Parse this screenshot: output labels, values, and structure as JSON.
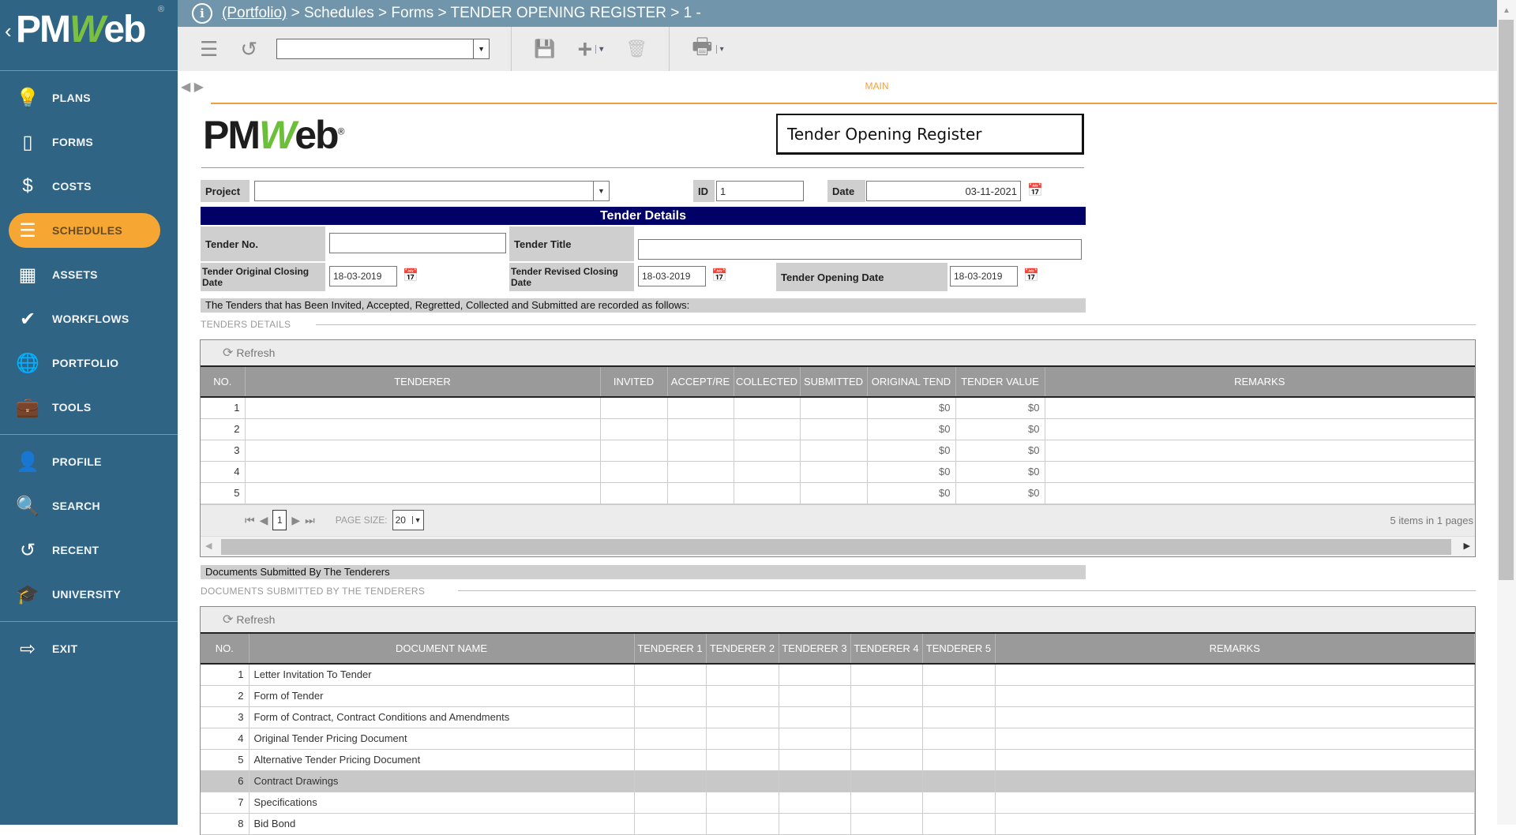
{
  "sidebar": {
    "logo": {
      "back": "‹",
      "text_pm": "PM",
      "text_w": "W",
      "text_eb": "eb",
      "reg": "®"
    },
    "group1": [
      {
        "label": "PLANS",
        "icon": "lightbulb-icon",
        "glyph": "💡"
      },
      {
        "label": "FORMS",
        "icon": "document-icon",
        "glyph": "▯"
      },
      {
        "label": "COSTS",
        "icon": "dollar-icon",
        "glyph": "$"
      },
      {
        "label": "SCHEDULES",
        "icon": "schedule-bars-icon",
        "glyph": "☰",
        "active": true
      },
      {
        "label": "ASSETS",
        "icon": "building-icon",
        "glyph": "▦"
      },
      {
        "label": "WORKFLOWS",
        "icon": "checkmark-icon",
        "glyph": "✔"
      },
      {
        "label": "PORTFOLIO",
        "icon": "globe-icon",
        "glyph": "🌐"
      },
      {
        "label": "TOOLS",
        "icon": "toolbox-icon",
        "glyph": "💼"
      }
    ],
    "group2": [
      {
        "label": "PROFILE",
        "icon": "user-icon",
        "glyph": "👤"
      },
      {
        "label": "SEARCH",
        "icon": "search-icon",
        "glyph": "🔍"
      },
      {
        "label": "RECENT",
        "icon": "history-icon",
        "glyph": "↺"
      },
      {
        "label": "UNIVERSITY",
        "icon": "graduation-cap-icon",
        "glyph": "🎓"
      }
    ],
    "group3": [
      {
        "label": "EXIT",
        "icon": "exit-icon",
        "glyph": "⇨"
      }
    ]
  },
  "breadcrumb": {
    "info": "i",
    "portfolio": "(Portfolio)",
    "rest": " > Schedules > Forms > TENDER OPENING REGISTER > 1 -"
  },
  "toolbar": {
    "list_icon": "☰",
    "history_icon": "↺",
    "record_select": "",
    "dropdown_arrow": "▼",
    "save_icon": "💾",
    "add_icon": "+",
    "delete_icon": "🗑",
    "print_icon": "🖶",
    "menu_arrow": "▾"
  },
  "tabs": {
    "arrows": "◀ ▶",
    "main": "MAIN"
  },
  "form": {
    "logo": {
      "pm": "PM",
      "w": "W",
      "eb": "eb",
      "reg": "®"
    },
    "title": "Tender Opening Register",
    "project_label": "Project",
    "project_value": "",
    "id_label": "ID",
    "id_value": "1",
    "date_label": "Date",
    "date_value": "03-11-2021",
    "section_title": "Tender Details",
    "tender_no_label": "Tender No.",
    "tender_no_value": "",
    "tender_title_label": "Tender Title",
    "tender_title_value": "",
    "orig_closing_label": "Tender Original Closing Date",
    "orig_closing_value": "18-03-2019",
    "revised_closing_label": "Tender Revised Closing Date",
    "revised_closing_value": "18-03-2019",
    "opening_label": "Tender Opening Date",
    "opening_value": "18-03-2019",
    "note": "The Tenders that has Been Invited, Accepted, Regretted, Collected and Submitted are recorded as follows:",
    "calendar_glyph": "📅"
  },
  "tenders": {
    "section": "TENDERS DETAILS",
    "refresh": "Refresh",
    "refresh_glyph": "⟳",
    "columns": [
      "NO.",
      "TENDERER",
      "INVITED",
      "ACCEPT/RE",
      "COLLECTED",
      "SUBMITTED",
      "ORIGINAL TEND",
      "TENDER VALUE",
      "REMARKS"
    ],
    "rows": [
      {
        "no": "1",
        "tenderer": "",
        "invited": "",
        "accept": "",
        "collected": "",
        "submitted": "",
        "original": "$0",
        "value": "$0",
        "remarks": ""
      },
      {
        "no": "2",
        "tenderer": "",
        "invited": "",
        "accept": "",
        "collected": "",
        "submitted": "",
        "original": "$0",
        "value": "$0",
        "remarks": ""
      },
      {
        "no": "3",
        "tenderer": "",
        "invited": "",
        "accept": "",
        "collected": "",
        "submitted": "",
        "original": "$0",
        "value": "$0",
        "remarks": ""
      },
      {
        "no": "4",
        "tenderer": "",
        "invited": "",
        "accept": "",
        "collected": "",
        "submitted": "",
        "original": "$0",
        "value": "$0",
        "remarks": ""
      },
      {
        "no": "5",
        "tenderer": "",
        "invited": "",
        "accept": "",
        "collected": "",
        "submitted": "",
        "original": "$0",
        "value": "$0",
        "remarks": ""
      }
    ],
    "pager": {
      "first": "⏮",
      "prev": "◀",
      "page": "1",
      "next": "▶",
      "last": "⏭",
      "page_size_label": "PAGE SIZE:",
      "page_size": "20",
      "info": "5 items in 1 pages"
    }
  },
  "documents": {
    "band": "Documents Submitted By The Tenderers",
    "section": "DOCUMENTS SUBMITTED BY THE TENDERERS",
    "refresh": "Refresh",
    "columns": [
      "NO.",
      "DOCUMENT NAME",
      "TENDERER 1",
      "TENDERER 2",
      "TENDERER 3",
      "TENDERER 4",
      "TENDERER 5",
      "REMARKS"
    ],
    "rows": [
      {
        "no": "1",
        "name": "Letter Invitation To Tender"
      },
      {
        "no": "2",
        "name": "Form of Tender"
      },
      {
        "no": "3",
        "name": "Form of Contract, Contract Conditions and Amendments"
      },
      {
        "no": "4",
        "name": "Original Tender Pricing Document"
      },
      {
        "no": "5",
        "name": "Alternative Tender Pricing Document"
      },
      {
        "no": "6",
        "name": "Contract Drawings",
        "selected": true
      },
      {
        "no": "7",
        "name": "Specifications"
      },
      {
        "no": "8",
        "name": "Bid Bond"
      }
    ]
  }
}
